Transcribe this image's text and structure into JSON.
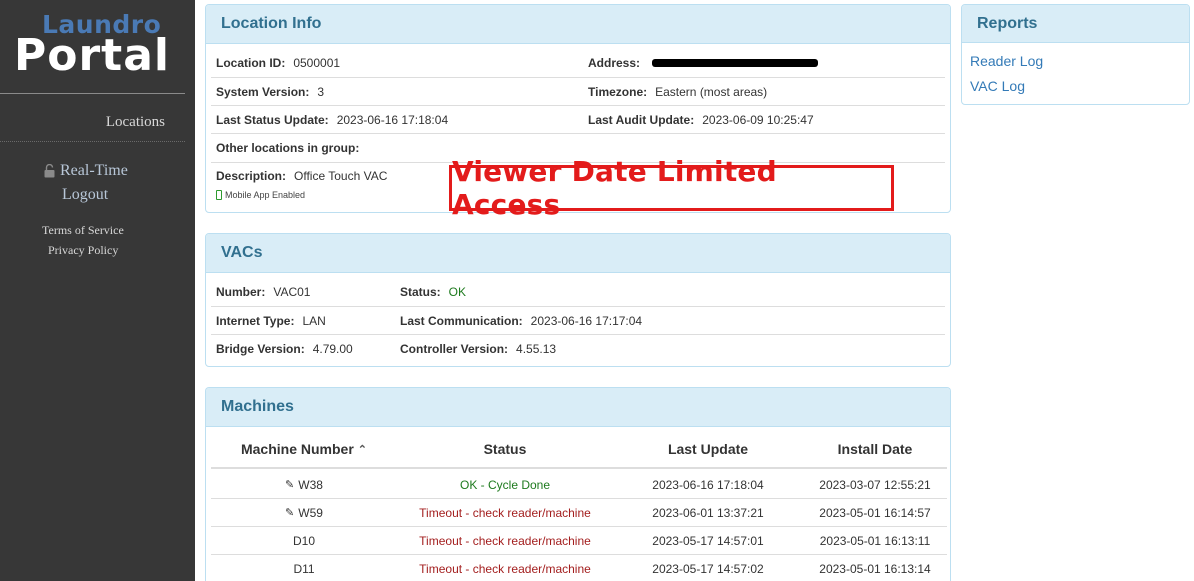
{
  "sidebar": {
    "logo_top": "Laundro",
    "logo_bottom": "Portal",
    "locations": "Locations",
    "realtime": "Real-Time",
    "logout": "Logout",
    "terms": "Terms of Service",
    "privacy": "Privacy Policy"
  },
  "location_info": {
    "title": "Location Info",
    "location_id_label": "Location ID:",
    "location_id": "0500001",
    "address_label": "Address:",
    "system_version_label": "System Version:",
    "system_version": "3",
    "timezone_label": "Timezone:",
    "timezone": "Eastern (most areas)",
    "last_status_label": "Last Status Update:",
    "last_status": "2023-06-16 17:18:04",
    "last_audit_label": "Last Audit Update:",
    "last_audit": "2023-06-09 10:25:47",
    "other_locations_label": "Other locations in group:",
    "description_label": "Description:",
    "description": "Office Touch VAC",
    "mobile_app": "Mobile App Enabled",
    "watermark": "Viewer Date Limited Access"
  },
  "vacs": {
    "title": "VACs",
    "number_label": "Number:",
    "number": "VAC01",
    "status_label": "Status:",
    "status": "OK",
    "internet_label": "Internet Type:",
    "internet": "LAN",
    "last_comm_label": "Last Communication:",
    "last_comm": "2023-06-16 17:17:04",
    "bridge_label": "Bridge Version:",
    "bridge": "4.79.00",
    "controller_label": "Controller Version:",
    "controller": "4.55.13"
  },
  "reports": {
    "title": "Reports",
    "links": [
      "Reader Log",
      "VAC Log"
    ]
  },
  "machines": {
    "title": "Machines",
    "headers": [
      "Machine Number",
      "Status",
      "Last Update",
      "Install Date"
    ],
    "sort_icon": "chevron-up-icon",
    "rows": [
      {
        "number": "W38",
        "status": "OK - Cycle Done",
        "status_type": "ok",
        "last_update": "2023-06-16 17:18:04",
        "install_date": "2023-03-07 12:55:21",
        "icon": "pencil-icon"
      },
      {
        "number": "W59",
        "status": "Timeout - check reader/machine",
        "status_type": "error",
        "last_update": "2023-06-01 13:37:21",
        "install_date": "2023-05-01 16:14:57",
        "icon": "pencil-icon"
      },
      {
        "number": "D10",
        "status": "Timeout - check reader/machine",
        "status_type": "error",
        "last_update": "2023-05-17 14:57:01",
        "install_date": "2023-05-01 16:13:11",
        "icon": ""
      },
      {
        "number": "D11",
        "status": "Timeout - check reader/machine",
        "status_type": "error",
        "last_update": "2023-05-17 14:57:02",
        "install_date": "2023-05-01 16:13:14",
        "icon": ""
      }
    ]
  },
  "colors": {
    "sidebar_bg": "#373737",
    "panel_head_bg": "#d9edf7",
    "panel_title": "#31708f",
    "ok": "#1e7a1e",
    "error": "#a31e1e",
    "watermark": "#e31b1b",
    "link": "#337ab7"
  }
}
